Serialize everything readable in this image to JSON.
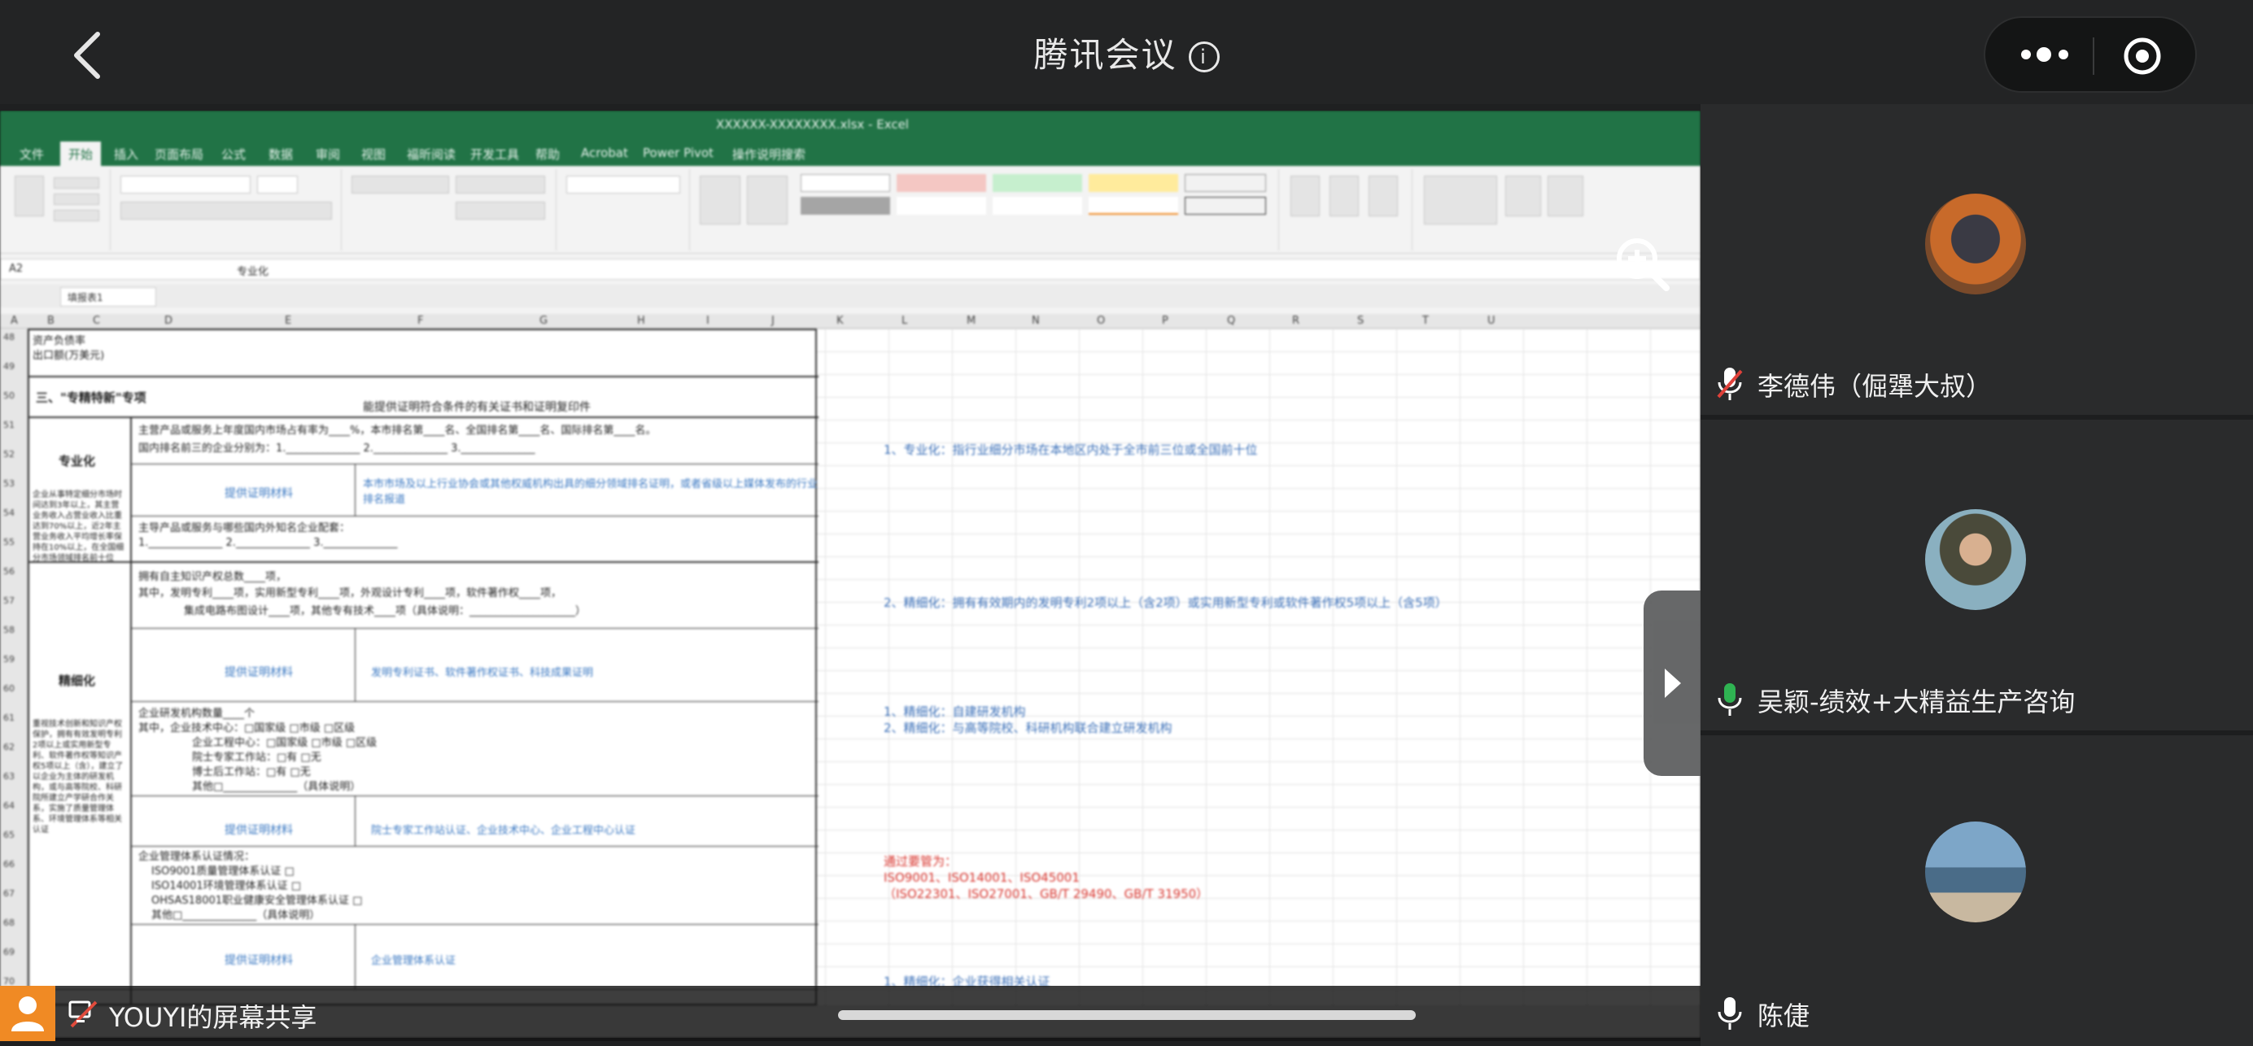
{
  "header": {
    "title": "腾讯会议",
    "back_icon": "chevron-left-icon",
    "info_icon": "info-icon",
    "more_icon": "more-dots-icon",
    "record_icon": "target-icon"
  },
  "excel": {
    "file_title": "XXXXXX-XXXXXXXX.xlsx - Excel",
    "tabs": [
      "文件",
      "开始",
      "插入",
      "页面布局",
      "公式",
      "数据",
      "审阅",
      "视图",
      "福昕阅读",
      "开发工具",
      "帮助",
      "Acrobat",
      "Power Pivot",
      "操作说明搜索"
    ],
    "name_box": "A2",
    "formula": "专业化",
    "sheet_tab": "填报表1",
    "columns": [
      "A",
      "B",
      "C",
      "D",
      "E",
      "F",
      "G",
      "H",
      "I",
      "J",
      "K",
      "L",
      "M",
      "N",
      "O",
      "P",
      "Q",
      "R",
      "S",
      "T",
      "U"
    ],
    "rows": [
      "48",
      "49",
      "50",
      "51",
      "52",
      "53",
      "54",
      "55",
      "56",
      "57",
      "58",
      "59",
      "60",
      "61",
      "62",
      "63",
      "64",
      "65",
      "66",
      "67",
      "68",
      "69",
      "70"
    ],
    "form": {
      "top_rows": [
        "资产负债率",
        "出口额(万美元)"
      ],
      "section_title": "三、\"专精特新\"专项",
      "section_sub": "能提供证明符合条件的有关证书和证明复印件",
      "zhuanye": "专业化",
      "zhuanye_desc": "主营产品或服务上年度国内市场占有率为____%，本市排名第____名、全国排名第____名、国际排名第____名。",
      "zhuanye_desc2": "国内排名前三的企业分别为：1.______________ 2.______________ 3.______________",
      "proof_label": "提供证明材料",
      "zhuanye_proof": "本市市场及以上行业协会或其他权威机构出具的细分领域排名证明，或者省级以上媒体发布的行业排名报道",
      "zhuanye_row2": "主导产品或服务与哪些国内外知名企业配套：",
      "zhuanye_row3": "1.______________ 2.______________ 3.______________",
      "jingxi": "精细化",
      "jingxi_desc1": "拥有自主知识产权总数____项，",
      "jingxi_desc2": "其中，发明专利____项，实用新型专利____项，外观设计专利____项，软件著作权____项，",
      "jingxi_desc3": "集成电路布图设计____项，其他专有技术____项（具体说明：____________________）",
      "jingxi_proof": "发明专利证书、软件著作权证书、科技成果证明",
      "rd_rows": [
        "企业研发机构数量____个",
        "其中，企业技术中心：□国家级 □市级 □区级",
        "企业工程中心：□国家级 □市级 □区级",
        "院士专家工作站：□有 □无",
        "博士后工作站：□有 □无",
        "其他□______________（具体说明）"
      ],
      "rd_proof": "院士专家工作站认证、企业技术中心、企业工程中心认证",
      "qm_rows": [
        "企业管理体系认证情况：",
        "ISO9001质量管理体系认证 □",
        "ISO14001环境管理体系认证 □",
        "OHSAS18001职业健康安全管理体系认证 □",
        "其他□______________（具体说明）"
      ],
      "qm_proof": "企业管理体系认证",
      "left_desc1": "企业从事特定细分市场时间达到3年以上，其主营业务收入占营业收入比重达到70%以上，近2年主营业务收入平均增长率保持在10%以上，在全国细分市场领域排名前十位",
      "left_desc2": "重视技术创新和知识产权保护，拥有有效发明专利2项以上或实用新型专利、软件著作权等知识产权5项以上（含），建立了以企业为主体的研发机构，或与高等院校、科研院所建立产学研合作关系，实施了质量管理体系、环境管理体系等相关认证"
    },
    "notes": {
      "n1": "1、专业化：指行业细分市场在本地区内处于全市前三位或全国前十位",
      "n2": "2、精细化：拥有有效期内的发明专利2项以上（含2项）或实用新型专利或软件著作权5项以上（含5项）",
      "n3a": "1、精细化：自建研发机构",
      "n3b": "2、精细化：与高等院校、科研机构联合建立研发机构",
      "r1": "通过要管为：",
      "r2": "ISO9001、ISO14001、ISO45001",
      "r3": "（ISO22301、ISO27001、GB/T 29490、GB/T 31950）",
      "n4": "1、精细化：企业获得相关认证"
    }
  },
  "footer": {
    "sharer_label": "YOUYI的屏幕共享",
    "share_icon": "screen-share-icon",
    "user_icon": "person-icon"
  },
  "participants": [
    {
      "name": "李德伟（倔犟大叔）",
      "mic": "mic-muted-icon",
      "avatar": "avatar-photo"
    },
    {
      "name": "吴颖-绩效+大精益生产咨询",
      "mic": "mic-active-icon",
      "avatar": "avatar-photo"
    },
    {
      "name": "陈倢",
      "mic": "mic-icon",
      "avatar": "avatar-photo"
    }
  ],
  "colors": {
    "excel_green": "#217346",
    "accent_orange": "#f08a24",
    "mic_green": "#2fb352",
    "note_blue": "#3a6fb8",
    "note_red": "#d8362f"
  }
}
